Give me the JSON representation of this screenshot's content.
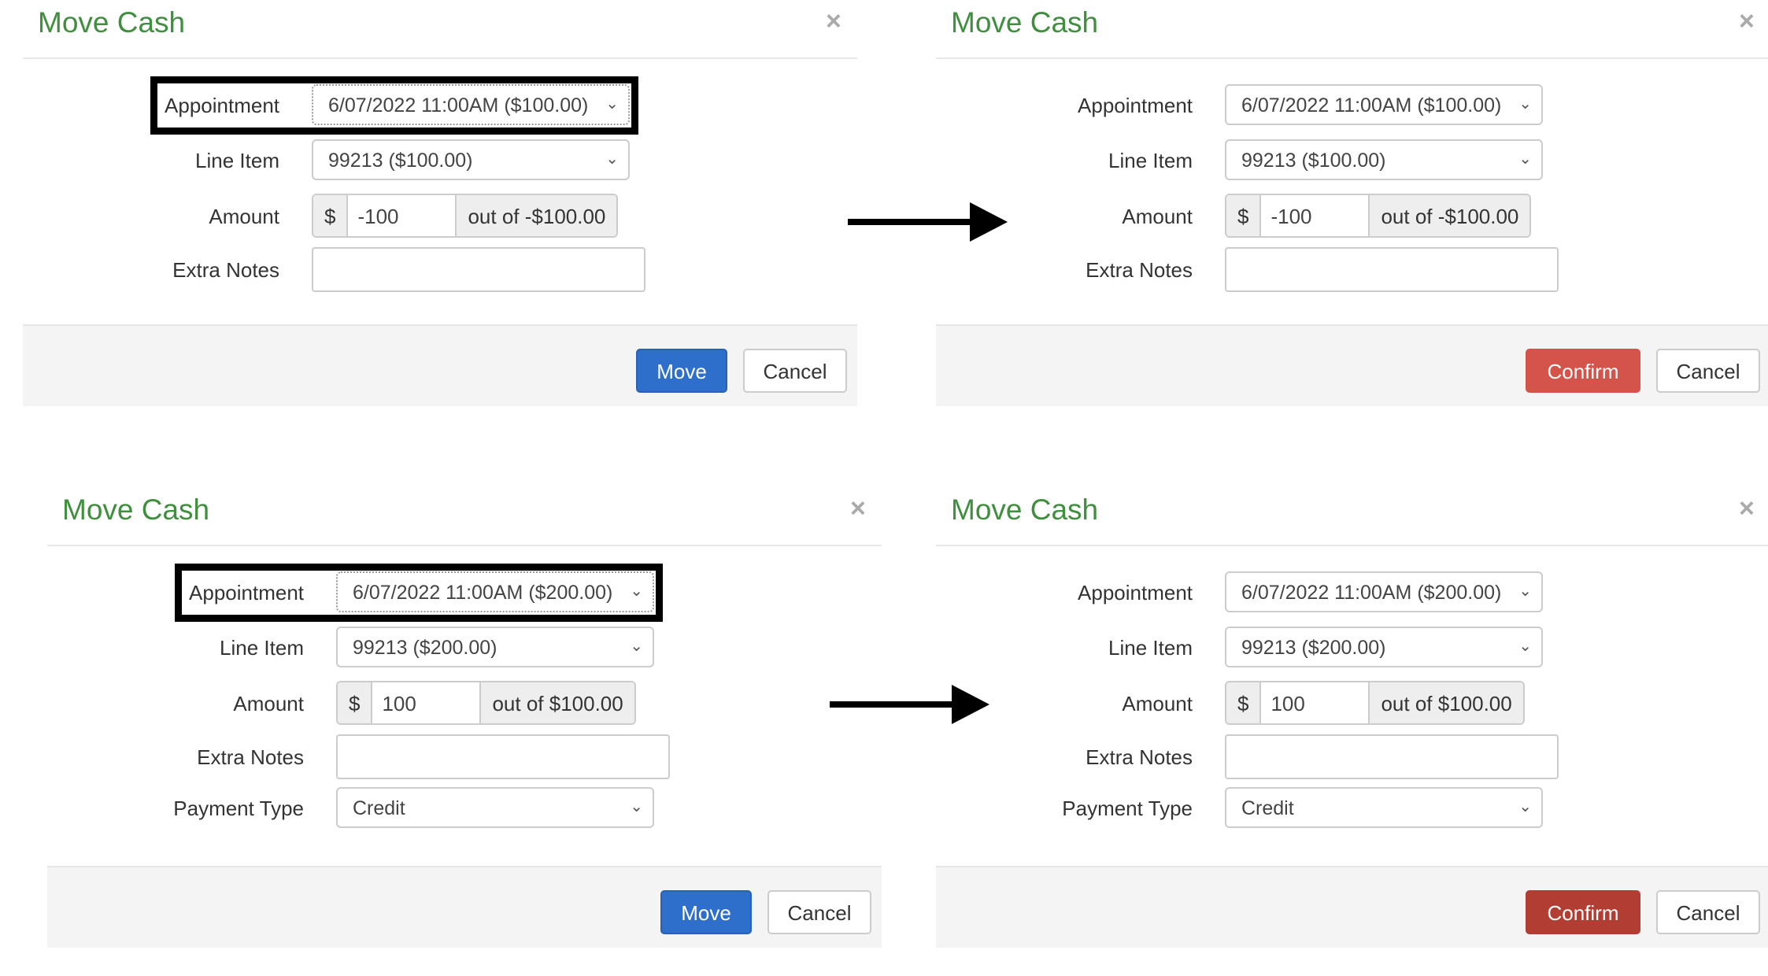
{
  "panels": [
    {
      "title": "Move Cash",
      "close": "×",
      "highlight": true,
      "fields": {
        "appointment_label": "Appointment",
        "appointment_value": "6/07/2022 11:00AM ($100.00)",
        "line_item_label": "Line Item",
        "line_item_value": "99213 ($100.00)",
        "amount_label": "Amount",
        "currency": "$",
        "amount_value": "-100",
        "out_of": "out of -$100.00",
        "notes_label": "Extra Notes",
        "notes_value": ""
      },
      "button": "Move",
      "button_type": "primary",
      "cancel": "Cancel"
    },
    {
      "title": "Move Cash",
      "close": "×",
      "highlight": false,
      "fields": {
        "appointment_label": "Appointment",
        "appointment_value": "6/07/2022 11:00AM ($100.00)",
        "line_item_label": "Line Item",
        "line_item_value": "99213 ($100.00)",
        "amount_label": "Amount",
        "currency": "$",
        "amount_value": "-100",
        "out_of": "out of -$100.00",
        "notes_label": "Extra Notes",
        "notes_value": ""
      },
      "button": "Confirm",
      "button_type": "confirm",
      "button_color": "#d4534a",
      "cancel": "Cancel"
    },
    {
      "title": "Move Cash",
      "close": "×",
      "highlight": true,
      "fields": {
        "appointment_label": "Appointment",
        "appointment_value": "6/07/2022 11:00AM ($200.00)",
        "line_item_label": "Line Item",
        "line_item_value": "99213 ($200.00)",
        "amount_label": "Amount",
        "currency": "$",
        "amount_value": "100",
        "out_of": "out of $100.00",
        "notes_label": "Extra Notes",
        "notes_value": "",
        "payment_type_label": "Payment Type",
        "payment_type_value": "Credit"
      },
      "button": "Move",
      "button_type": "primary",
      "cancel": "Cancel"
    },
    {
      "title": "Move Cash",
      "close": "×",
      "highlight": false,
      "fields": {
        "appointment_label": "Appointment",
        "appointment_value": "6/07/2022 11:00AM ($200.00)",
        "line_item_label": "Line Item",
        "line_item_value": "99213 ($200.00)",
        "amount_label": "Amount",
        "currency": "$",
        "amount_value": "100",
        "out_of": "out of $100.00",
        "notes_label": "Extra Notes",
        "notes_value": "",
        "payment_type_label": "Payment Type",
        "payment_type_value": "Credit"
      },
      "button": "Confirm",
      "button_type": "confirm",
      "button_color": "#b23e33",
      "cancel": "Cancel"
    }
  ],
  "colors": {
    "title": "#3f8f3f",
    "primary": "#2e6fcb",
    "footer": "#f4f4f4"
  }
}
